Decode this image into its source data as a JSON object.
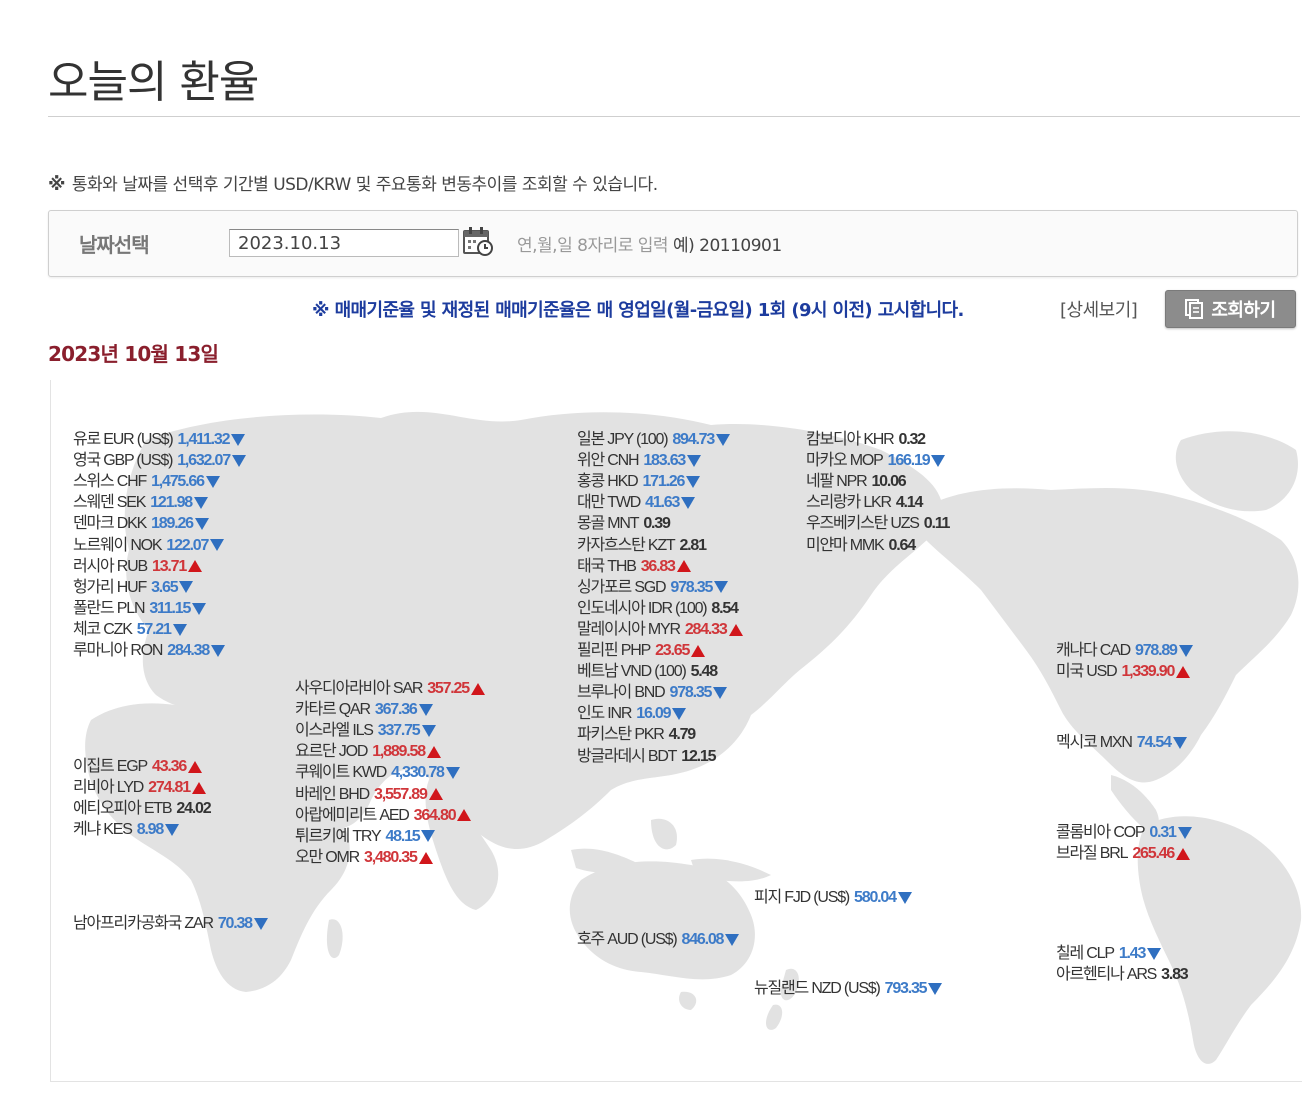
{
  "page": {
    "title": "오늘의 환율",
    "notice_mark": "※",
    "notice_text": "통화와 날짜를 선택후 기간별 USD/KRW 및 주요통화 변동추이를 조회할 수 있습니다."
  },
  "date_select": {
    "label": "날짜선택",
    "value": "2023.10.13",
    "hint": "연,월,일 8자리로 입력",
    "example": "예) 20110901"
  },
  "rate_notice": "※ 매매기준율 및 재정된 매매기준율은 매 영업일(월-금요일) 1회 (9시 이전) 고시합니다.",
  "detail_link": "[상세보기]",
  "query_button": "조회하기",
  "date_heading": {
    "year": "2023",
    "year_unit": "년",
    "month": "10",
    "month_unit": "월",
    "day": "13",
    "day_unit": "일"
  },
  "colors": {
    "down": "#3d7bc8",
    "up": "#d0363a",
    "heading": "#8a1f2d",
    "notice": "#1d3c9e",
    "map": "#e2e2e2"
  },
  "rates": {
    "europe": [
      {
        "name": "유로 EUR (US$)",
        "value": "1,411.32",
        "trend": "down"
      },
      {
        "name": "영국 GBP (US$)",
        "value": "1,632.07",
        "trend": "down"
      },
      {
        "name": "스위스 CHF",
        "value": "1,475.66",
        "trend": "down"
      },
      {
        "name": "스웨덴 SEK",
        "value": "121.98",
        "trend": "down"
      },
      {
        "name": "덴마크 DKK",
        "value": "189.26",
        "trend": "down"
      },
      {
        "name": "노르웨이 NOK",
        "value": "122.07",
        "trend": "down"
      },
      {
        "name": "러시아 RUB",
        "value": "13.71",
        "trend": "up"
      },
      {
        "name": "헝가리 HUF",
        "value": "3.65",
        "trend": "down"
      },
      {
        "name": "폴란드 PLN",
        "value": "311.15",
        "trend": "down"
      },
      {
        "name": "체코 CZK",
        "value": "57.21",
        "trend": "down"
      },
      {
        "name": "루마니아 RON",
        "value": "284.38",
        "trend": "down"
      }
    ],
    "africa": [
      {
        "name": "이집트 EGP",
        "value": "43.36",
        "trend": "up"
      },
      {
        "name": "리비아 LYD",
        "value": "274.81",
        "trend": "up"
      },
      {
        "name": "에티오피아 ETB",
        "value": "24.02",
        "trend": "flat"
      },
      {
        "name": "케냐 KES",
        "value": "8.98",
        "trend": "down"
      }
    ],
    "south_africa": [
      {
        "name": "남아프리카공화국 ZAR",
        "value": "70.38",
        "trend": "down"
      }
    ],
    "middle_east": [
      {
        "name": "사우디아라비아 SAR",
        "value": "357.25",
        "trend": "up"
      },
      {
        "name": "카타르 QAR",
        "value": "367.36",
        "trend": "down"
      },
      {
        "name": "이스라엘 ILS",
        "value": "337.75",
        "trend": "down"
      },
      {
        "name": "요르단 JOD",
        "value": "1,889.58",
        "trend": "up"
      },
      {
        "name": "쿠웨이트 KWD",
        "value": "4,330.78",
        "trend": "down"
      },
      {
        "name": "바레인 BHD",
        "value": "3,557.89",
        "trend": "up"
      },
      {
        "name": "아랍에미리트 AED",
        "value": "364.80",
        "trend": "up"
      },
      {
        "name": "튀르키예 TRY",
        "value": "48.15",
        "trend": "down"
      },
      {
        "name": "오만 OMR",
        "value": "3,480.35",
        "trend": "up"
      }
    ],
    "asia": [
      {
        "name": "일본 JPY (100)",
        "value": "894.73",
        "trend": "down"
      },
      {
        "name": "위안 CNH",
        "value": "183.63",
        "trend": "down"
      },
      {
        "name": "홍콩 HKD",
        "value": "171.26",
        "trend": "down"
      },
      {
        "name": "대만 TWD",
        "value": "41.63",
        "trend": "down"
      },
      {
        "name": "몽골 MNT",
        "value": "0.39",
        "trend": "flat"
      },
      {
        "name": "카자흐스탄 KZT",
        "value": "2.81",
        "trend": "flat"
      },
      {
        "name": "태국 THB",
        "value": "36.83",
        "trend": "up"
      },
      {
        "name": "싱가포르 SGD",
        "value": "978.35",
        "trend": "down"
      },
      {
        "name": "인도네시아 IDR (100)",
        "value": "8.54",
        "trend": "flat"
      },
      {
        "name": "말레이시아 MYR",
        "value": "284.33",
        "trend": "up"
      },
      {
        "name": "필리핀 PHP",
        "value": "23.65",
        "trend": "up"
      },
      {
        "name": "베트남 VND (100)",
        "value": "5.48",
        "trend": "flat"
      },
      {
        "name": "브루나이 BND",
        "value": "978.35",
        "trend": "down"
      },
      {
        "name": "인도 INR",
        "value": "16.09",
        "trend": "down"
      },
      {
        "name": "파키스탄 PKR",
        "value": "4.79",
        "trend": "flat"
      },
      {
        "name": "방글라데시 BDT",
        "value": "12.15",
        "trend": "flat"
      }
    ],
    "asia2": [
      {
        "name": "캄보디아 KHR",
        "value": "0.32",
        "trend": "flat"
      },
      {
        "name": "마카오 MOP",
        "value": "166.19",
        "trend": "down"
      },
      {
        "name": "네팔 NPR",
        "value": "10.06",
        "trend": "flat"
      },
      {
        "name": "스리랑카 LKR",
        "value": "4.14",
        "trend": "flat"
      },
      {
        "name": "우즈베키스탄 UZS",
        "value": "0.11",
        "trend": "flat"
      },
      {
        "name": "미얀마 MMK",
        "value": "0.64",
        "trend": "flat"
      }
    ],
    "north_america": [
      {
        "name": "캐나다 CAD",
        "value": "978.89",
        "trend": "down"
      },
      {
        "name": "미국 USD",
        "value": "1,339.90",
        "trend": "up"
      }
    ],
    "mexico": [
      {
        "name": "멕시코 MXN",
        "value": "74.54",
        "trend": "down"
      }
    ],
    "south_america": [
      {
        "name": "콜롬비아 COP",
        "value": "0.31",
        "trend": "down"
      },
      {
        "name": "브라질 BRL",
        "value": "265.46",
        "trend": "up"
      }
    ],
    "south_america2": [
      {
        "name": "칠레 CLP",
        "value": "1.43",
        "trend": "down"
      },
      {
        "name": "아르헨티나 ARS",
        "value": "3.83",
        "trend": "flat"
      }
    ],
    "fiji": [
      {
        "name": "피지 FJD (US$)",
        "value": "580.04",
        "trend": "down"
      }
    ],
    "australia": [
      {
        "name": "호주 AUD (US$)",
        "value": "846.08",
        "trend": "down"
      }
    ],
    "new_zealand": [
      {
        "name": "뉴질랜드 NZD (US$)",
        "value": "793.35",
        "trend": "down"
      }
    ]
  }
}
